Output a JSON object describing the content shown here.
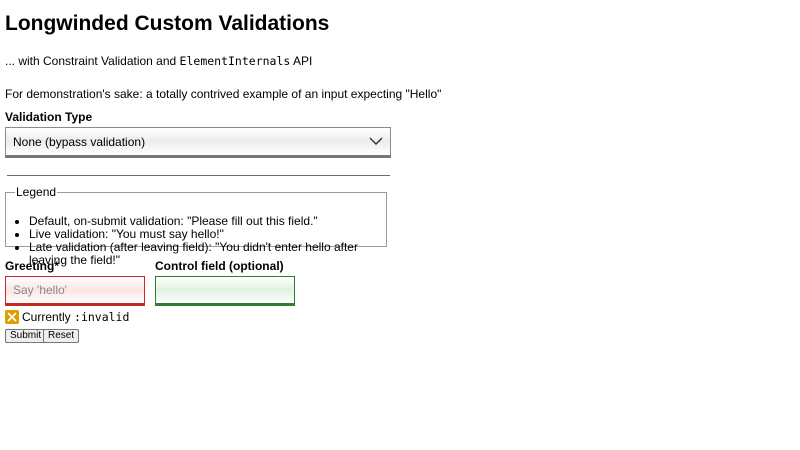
{
  "page": {
    "title": "Longwinded Custom Validations",
    "subtitle_prefix": "... with Constraint Validation and ",
    "subtitle_code": "ElementInternals",
    "subtitle_suffix": " API",
    "intro": "For demonstration's sake: a totally contrived example of an input expecting \"Hello\""
  },
  "validation_type": {
    "label": "Validation Type",
    "selected": "None (bypass validation)",
    "icon": "chevron-down-icon"
  },
  "legend": {
    "title": "Legend",
    "items": [
      "Default, on-submit validation: \"Please fill out this field.\"",
      "Live validation: \"You must say hello!\"",
      "Late validation (after leaving field): \"You didn't enter hello after leaving the field!\""
    ]
  },
  "greeting": {
    "label": "Greeting*",
    "value": "",
    "placeholder": "Say 'hello'",
    "state_color": "#c62828"
  },
  "control": {
    "label": "Control field (optional)",
    "value": "",
    "placeholder": "",
    "state_color": "#2e7d32"
  },
  "status": {
    "icon": "cross-mark-icon",
    "icon_color": "#d8a000",
    "prefix": "Currently ",
    "state": ":invalid"
  },
  "buttons": {
    "submit": "Submit",
    "reset": "Reset"
  }
}
